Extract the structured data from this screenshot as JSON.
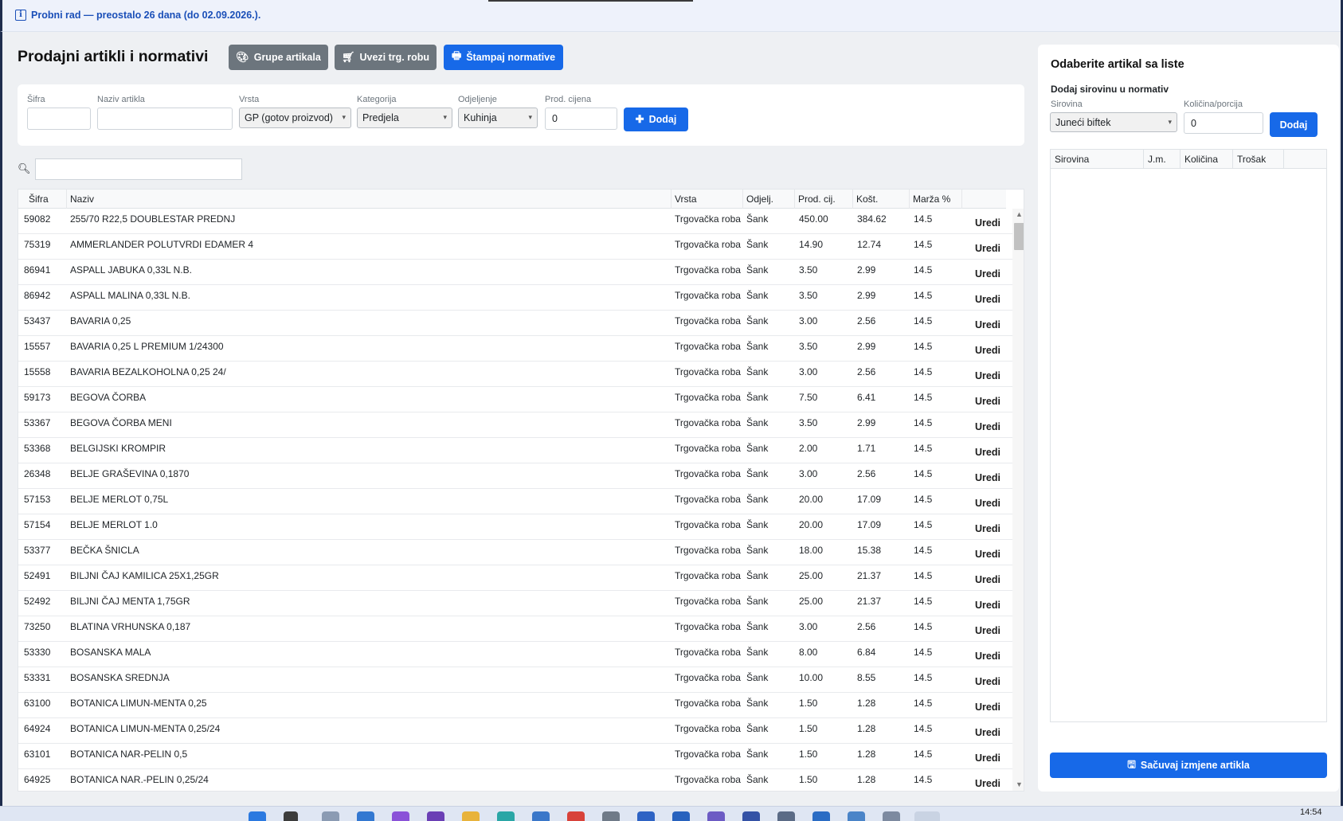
{
  "trial_banner": {
    "icon": "info-icon",
    "text": "Probni rad — preostalo 26 dana (do 02.09.2026.)."
  },
  "header": {
    "title": "Prodajni artikli i normativi",
    "buttons": {
      "groups": "Grupe artikala",
      "import": "Uvezi trg. robu",
      "print": "Štampaj normative"
    }
  },
  "form": {
    "sifra_label": "Šifra",
    "sifra_value": "",
    "naziv_label": "Naziv artikla",
    "naziv_value": "",
    "vrsta_label": "Vrsta",
    "vrsta_value": "GP (gotov proizvod)",
    "kategorija_label": "Kategorija",
    "kategorija_value": "Predjela",
    "odjeljenje_label": "Odjeljenje",
    "odjeljenje_value": "Kuhinja",
    "cijena_label": "Prod. cijena",
    "cijena_value": "0",
    "add_label": "Dodaj"
  },
  "search": {
    "icon": "magnifier-icon",
    "value": ""
  },
  "table": {
    "headers": {
      "sifra": "Šifra",
      "naziv": "Naziv",
      "vrsta": "Vrsta",
      "odjel": "Odjelj.",
      "cijena": "Prod. cij.",
      "kost": "Košt.",
      "marza": "Marža %"
    },
    "edit_label": "Uredi",
    "rows": [
      [
        "59082",
        "255/70 R22,5 DOUBLESTAR PREDNJ",
        "Trgovačka roba",
        "Šank",
        "450.00",
        "384.62",
        "14.5"
      ],
      [
        "75319",
        "AMMERLANDER POLUTVRDI EDAMER 4",
        "Trgovačka roba",
        "Šank",
        "14.90",
        "12.74",
        "14.5"
      ],
      [
        "86941",
        "ASPALL JABUKA 0,33L N.B.",
        "Trgovačka roba",
        "Šank",
        "3.50",
        "2.99",
        "14.5"
      ],
      [
        "86942",
        "ASPALL MALINA 0,33L N.B.",
        "Trgovačka roba",
        "Šank",
        "3.50",
        "2.99",
        "14.5"
      ],
      [
        "53437",
        "BAVARIA 0,25",
        "Trgovačka roba",
        "Šank",
        "3.00",
        "2.56",
        "14.5"
      ],
      [
        "15557",
        "BAVARIA 0,25 L PREMIUM 1/24300",
        "Trgovačka roba",
        "Šank",
        "3.50",
        "2.99",
        "14.5"
      ],
      [
        "15558",
        "BAVARIA BEZALKOHOLNA 0,25  24/",
        "Trgovačka roba",
        "Šank",
        "3.00",
        "2.56",
        "14.5"
      ],
      [
        "59173",
        "BEGOVA ČORBA",
        "Trgovačka roba",
        "Šank",
        "7.50",
        "6.41",
        "14.5"
      ],
      [
        "53367",
        "BEGOVA ČORBA MENI",
        "Trgovačka roba",
        "Šank",
        "3.50",
        "2.99",
        "14.5"
      ],
      [
        "53368",
        "BELGIJSKI KROMPIR",
        "Trgovačka roba",
        "Šank",
        "2.00",
        "1.71",
        "14.5"
      ],
      [
        "26348",
        "BELJE GRAŠEVINA 0,1870",
        "Trgovačka roba",
        "Šank",
        "3.00",
        "2.56",
        "14.5"
      ],
      [
        "57153",
        "BELJE MERLOT 0,75L",
        "Trgovačka roba",
        "Šank",
        "20.00",
        "17.09",
        "14.5"
      ],
      [
        "57154",
        "BELJE MERLOT 1.0",
        "Trgovačka roba",
        "Šank",
        "20.00",
        "17.09",
        "14.5"
      ],
      [
        "53377",
        "BEČKA ŠNICLA",
        "Trgovačka roba",
        "Šank",
        "18.00",
        "15.38",
        "14.5"
      ],
      [
        "52491",
        "BILJNI ČAJ KAMILICA 25X1,25GR",
        "Trgovačka roba",
        "Šank",
        "25.00",
        "21.37",
        "14.5"
      ],
      [
        "52492",
        "BILJNI ČAJ MENTA 1,75GR",
        "Trgovačka roba",
        "Šank",
        "25.00",
        "21.37",
        "14.5"
      ],
      [
        "73250",
        "BLATINA VRHUNSKA 0,187",
        "Trgovačka roba",
        "Šank",
        "3.00",
        "2.56",
        "14.5"
      ],
      [
        "53330",
        "BOSANSKA MALA",
        "Trgovačka roba",
        "Šank",
        "8.00",
        "6.84",
        "14.5"
      ],
      [
        "53331",
        "BOSANSKA SREDNJA",
        "Trgovačka roba",
        "Šank",
        "10.00",
        "8.55",
        "14.5"
      ],
      [
        "63100",
        "BOTANICA LIMUN-MENTA 0,25",
        "Trgovačka roba",
        "Šank",
        "1.50",
        "1.28",
        "14.5"
      ],
      [
        "64924",
        "BOTANICA LIMUN-MENTA 0,25/24",
        "Trgovačka roba",
        "Šank",
        "1.50",
        "1.28",
        "14.5"
      ],
      [
        "63101",
        "BOTANICA NAR-PELIN 0,5",
        "Trgovačka roba",
        "Šank",
        "1.50",
        "1.28",
        "14.5"
      ],
      [
        "64925",
        "BOTANICA NAR.-PELIN 0,25/24",
        "Trgovačka roba",
        "Šank",
        "1.50",
        "1.28",
        "14.5"
      ]
    ]
  },
  "right_panel": {
    "title": "Odaberite artikal sa liste",
    "subtitle": "Dodaj sirovinu u normativ",
    "sirovina_label": "Sirovina",
    "sirovina_value": "Juneći biftek",
    "kolicina_label": "Količina/porcija",
    "kolicina_value": "0",
    "add_label": "Dodaj",
    "table_headers": {
      "sirovina": "Sirovina",
      "jm": "J.m.",
      "kolicina": "Količina",
      "trosak": "Trošak"
    },
    "save_label": "Sačuvaj izmjene artikla"
  },
  "taskbar": {
    "time": "14:54"
  }
}
